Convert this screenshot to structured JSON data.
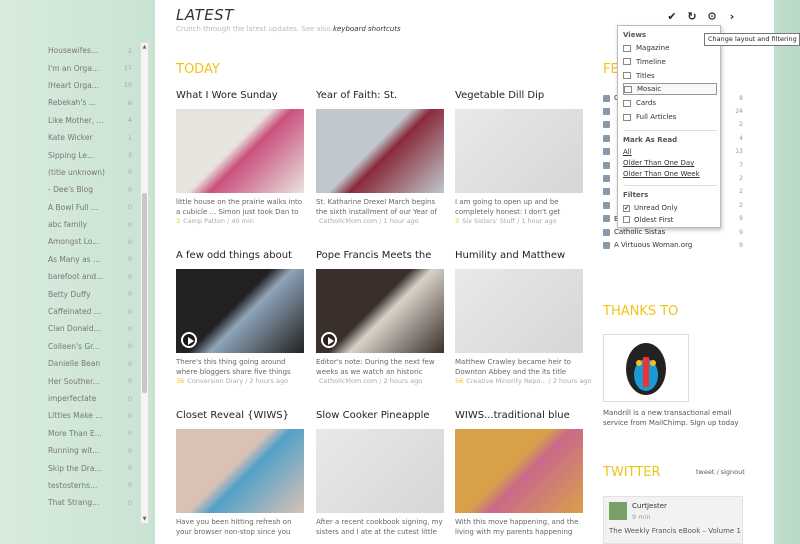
{
  "header": {
    "title": "LATEST",
    "subtitle": "Crunch through the latest updates. See also ",
    "shortcuts_link": "keyboard shortcuts"
  },
  "section_today": "TODAY",
  "toolbar": {
    "mark_read": "✔",
    "refresh": "↻",
    "settings": "⚙",
    "next": "›"
  },
  "tooltip": "Change layout and filtering",
  "sidebar": {
    "items": [
      {
        "label": "Housewifes...",
        "count": "2"
      },
      {
        "label": "I'm an Orga...",
        "count": "17"
      },
      {
        "label": "IHeart Orga...",
        "count": "10"
      },
      {
        "label": "Rebekah's ...",
        "count": "6"
      },
      {
        "label": "Like Mother, ...",
        "count": "4"
      },
      {
        "label": "Kate Wicker",
        "count": "1"
      },
      {
        "label": "Sipping Le...",
        "count": "3"
      },
      {
        "label": "(title unknown)",
        "count": "0"
      },
      {
        "label": "- Dee's Blog",
        "count": "0"
      },
      {
        "label": "A Bowl Full ...",
        "count": "0"
      },
      {
        "label": "abc family",
        "count": "0"
      },
      {
        "label": "Amongst Lo...",
        "count": "0"
      },
      {
        "label": "As Many as ...",
        "count": "0"
      },
      {
        "label": "barefoot and...",
        "count": "0"
      },
      {
        "label": "Betty Duffy",
        "count": "0"
      },
      {
        "label": "Caffeinated ...",
        "count": "0"
      },
      {
        "label": "Clan Donald...",
        "count": "0"
      },
      {
        "label": "Colleen's Gr...",
        "count": "0"
      },
      {
        "label": "Danielle Bean",
        "count": "0"
      },
      {
        "label": "Her Souther...",
        "count": "0"
      },
      {
        "label": "imperfectate",
        "count": "0"
      },
      {
        "label": "Littles Make ...",
        "count": "0"
      },
      {
        "label": "More Than E...",
        "count": "0"
      },
      {
        "label": "Running wit...",
        "count": "0"
      },
      {
        "label": "Skip the Dra...",
        "count": "0"
      },
      {
        "label": "testosterns...",
        "count": "0"
      },
      {
        "label": "That Strang...",
        "count": "0"
      }
    ]
  },
  "cards": [
    {
      "title": "What I Wore Sunday",
      "excerpt": "little house on the prairie walks into a cubicle ... Simon just took Dan to",
      "num": "3",
      "meta": "Camp Patton / 40 min",
      "thumb": "photo"
    },
    {
      "title": "Year of Faith: St.",
      "excerpt": "St. Katharine Drexel March begins the sixth installment of our Year of",
      "num": "",
      "meta": "CatholicMom.com / 1 hour ago",
      "thumb": "photo"
    },
    {
      "title": "Vegetable Dill Dip",
      "excerpt": "I am going to open up and be completely honest: I don't get excited",
      "num": "3",
      "meta": "Six Sisters' Stuff / 1 hour ago",
      "thumb": "blank"
    },
    {
      "title": "A few odd things about",
      "excerpt": "There's this thing going around where bloggers share five things",
      "num": "36",
      "meta": "Conversion Diary / 2 hours ago",
      "thumb": "video"
    },
    {
      "title": "Pope Francis Meets the",
      "excerpt": "Editor's note: During the next few weeks as we watch an historic",
      "num": "",
      "meta": "CatholicMom.com / 2 hours ago",
      "thumb": "video"
    },
    {
      "title": "Humility and Matthew",
      "excerpt": "Matthew Crawley became heir to Downton Abbey and the its title quite",
      "num": "56",
      "meta": "Creative Minority Repo... / 2 hours ago",
      "thumb": "blank"
    },
    {
      "title": "Closet Reveal {WIWS}",
      "excerpt": "Have you been hitting refresh on your browser non-stop since you saw",
      "num": "",
      "meta": "",
      "thumb": "photo"
    },
    {
      "title": "Slow Cooker Pineapple",
      "excerpt": "After a recent cookbook signing, my sisters and I ate at the cutest little",
      "num": "",
      "meta": "",
      "thumb": "blank"
    },
    {
      "title": "WIWS...traditional blue",
      "excerpt": "With this move happening, and the living with my parents happening",
      "num": "",
      "meta": "",
      "thumb": "photo"
    }
  ],
  "feeds": {
    "title": "FE",
    "items": [
      {
        "label": "CP",
        "count": "8"
      },
      {
        "label": "",
        "count": "24"
      },
      {
        "label": "",
        "count": "2"
      },
      {
        "label": "",
        "count": "4"
      },
      {
        "label": "",
        "count": "13"
      },
      {
        "label": "",
        "count": "7"
      },
      {
        "label": "",
        "count": "2"
      },
      {
        "label": "",
        "count": "2"
      },
      {
        "label": "",
        "count": "2"
      },
      {
        "label": "By Sun and Candlelight",
        "count": "9"
      },
      {
        "label": "Catholic Sistas",
        "count": "9"
      },
      {
        "label": "A Virtuous Woman.org",
        "count": "9"
      }
    ]
  },
  "thanks": {
    "title": "THANKS TO",
    "text": "Mandrill is a new transactional email service from MailChimp. Sign up today"
  },
  "twitter": {
    "title": "TWITTER",
    "links": "tweet / signout",
    "user": "CurtJester",
    "time": "9 min",
    "text": "The Weekly Francis eBook – Volume 1"
  },
  "popup": {
    "views_label": "Views",
    "views": [
      "Magazine",
      "Timeline",
      "Titles",
      "Mosaic",
      "Cards",
      "Full Articles"
    ],
    "mark_label": "Mark As Read",
    "mark": [
      "All",
      "Older Than One Day",
      "Older Than One Week"
    ],
    "filters_label": "Filters",
    "filters": [
      {
        "label": "Unread Only",
        "checked": "✔"
      },
      {
        "label": "Oldest First",
        "checked": ""
      }
    ]
  }
}
